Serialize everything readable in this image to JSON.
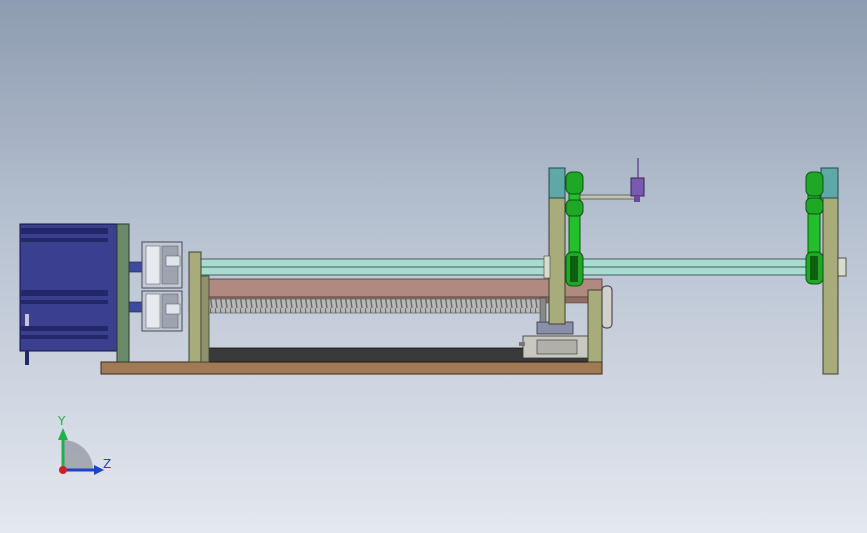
{
  "colors": {
    "background_top": "#8e9cb1",
    "background_bottom": "#e4e8ef",
    "motor_body": "#3a3f8e",
    "motor_dark": "#24286a",
    "frame_plate": "#a8ab7a",
    "frame_plate_dark": "#6f7250",
    "motor_plate": "#6a8a6a",
    "shaft_light": "#a9dcd1",
    "shaft_dark": "#3d5f5a",
    "screw_housing": "#b08a80",
    "lead_screw": "#b9b9b9",
    "base_plate": "#a07a55",
    "rail_dark": "#3a3a3a",
    "coupling": "#c4c8d4",
    "belt_green": "#22c02a",
    "teal_block": "#5fa8a8",
    "sensor_purple": "#7a5ab0",
    "axis_y": "#22b04a",
    "axis_z": "#2040d0",
    "axis_origin": "#d02020",
    "triad_quarter": "#9aa0a8"
  },
  "icons": {
    "coordinate_triad": "coordinate-triad-icon"
  },
  "triad": {
    "y_label": "Y",
    "z_label": "Z"
  }
}
